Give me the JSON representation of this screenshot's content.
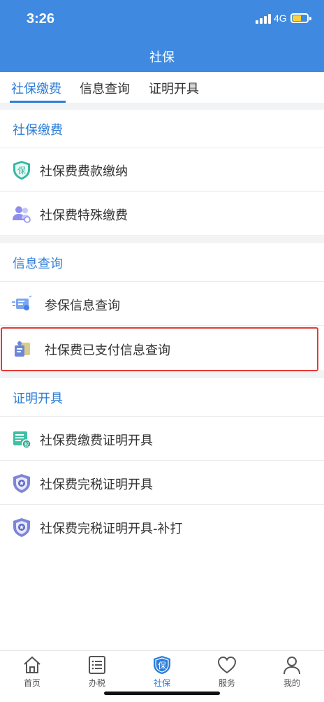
{
  "status_bar": {
    "time": "3:26",
    "network": "4G"
  },
  "header": {
    "title": "社保"
  },
  "tabs": [
    {
      "label": "社保缴费",
      "active": true
    },
    {
      "label": "信息查询",
      "active": false
    },
    {
      "label": "证明开具",
      "active": false
    }
  ],
  "sections": [
    {
      "title": "社保缴费",
      "items": [
        {
          "label": "社保费费款缴纳",
          "icon": "shield-bao-icon"
        },
        {
          "label": "社保费特殊缴费",
          "icon": "people-icon"
        }
      ]
    },
    {
      "title": "信息查询",
      "items": [
        {
          "label": "参保信息查询",
          "icon": "info-card-icon"
        },
        {
          "label": "社保费已支付信息查询",
          "icon": "payment-info-icon",
          "highlighted": true
        }
      ]
    },
    {
      "title": "证明开具",
      "items": [
        {
          "label": "社保费缴费证明开具",
          "icon": "tax-document-icon"
        },
        {
          "label": "社保费完税证明开具",
          "icon": "star-badge-icon"
        },
        {
          "label": "社保费完税证明开具-补打",
          "icon": "star-badge-icon"
        }
      ]
    }
  ],
  "bottom_nav": [
    {
      "label": "首页",
      "icon": "home-icon",
      "active": false
    },
    {
      "label": "办税",
      "icon": "list-icon",
      "active": false
    },
    {
      "label": "社保",
      "icon": "shield-bao-icon",
      "active": true
    },
    {
      "label": "服务",
      "icon": "heart-icon",
      "active": false
    },
    {
      "label": "我的",
      "icon": "user-icon",
      "active": false
    }
  ],
  "colors": {
    "primary": "#3f8ae0",
    "accent_text": "#2d7ed8",
    "highlight_border": "#e53935",
    "section_gap": "#f2f3f5"
  }
}
